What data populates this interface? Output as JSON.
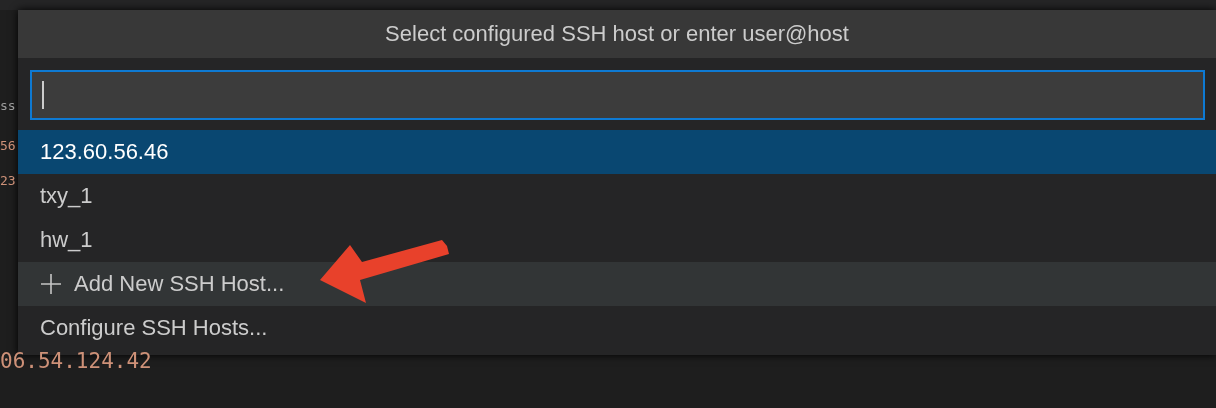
{
  "editor_fragments": [
    {
      "text": "ss",
      "kind": "plain"
    },
    {
      "text": "56",
      "kind": "string"
    },
    {
      "text": "23",
      "kind": "string"
    }
  ],
  "quick_pick": {
    "title": "Select configured SSH host or enter user@host",
    "items": [
      {
        "label": "123.60.56.46",
        "kind": "host",
        "selected": true,
        "hovered": false
      },
      {
        "label": "txy_1",
        "kind": "host",
        "selected": false,
        "hovered": false
      },
      {
        "label": "hw_1",
        "kind": "host",
        "selected": false,
        "hovered": false
      },
      {
        "label": "Add New SSH Host...",
        "kind": "add",
        "selected": false,
        "hovered": true
      },
      {
        "label": "Configure SSH Hosts...",
        "kind": "action",
        "selected": false,
        "hovered": false
      }
    ]
  },
  "editor_bottom_line": {
    "text": "06.54.124.42",
    "kind": "string"
  }
}
